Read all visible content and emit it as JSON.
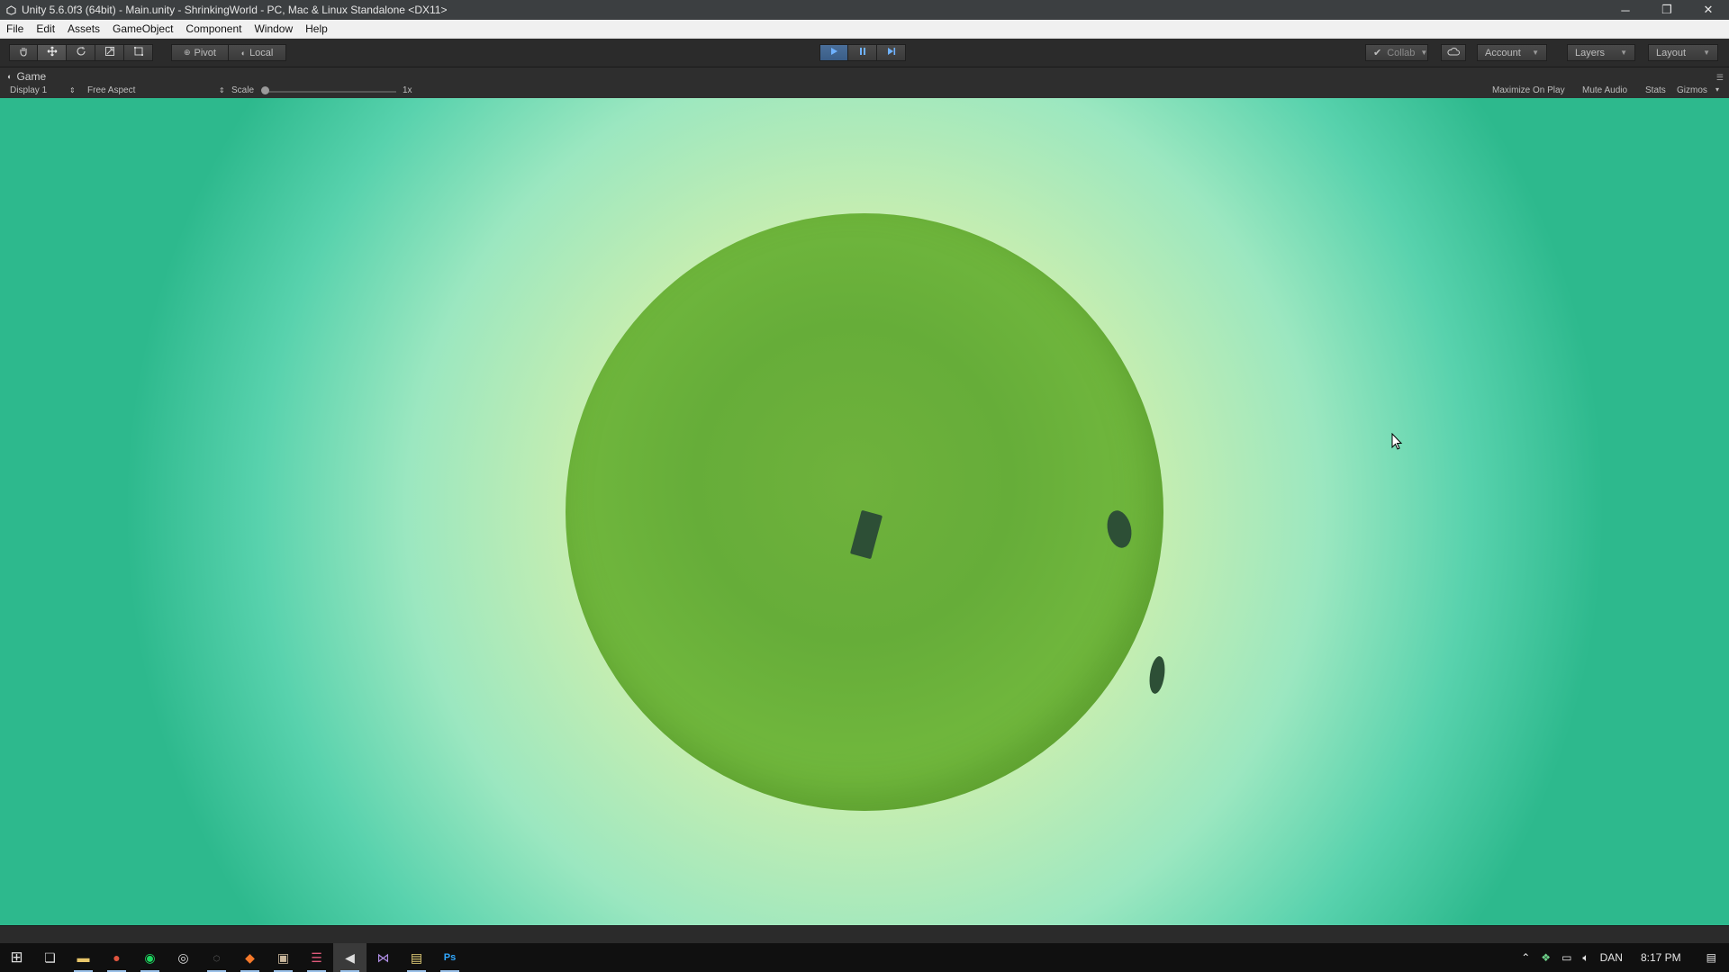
{
  "window": {
    "title": "Unity 5.6.0f3 (64bit) - Main.unity - ShrinkingWorld - PC, Mac & Linux Standalone <DX11>",
    "controls": {
      "minimize": "─",
      "restore": "❐",
      "close": "✕"
    }
  },
  "menu": {
    "items": [
      {
        "label": "File"
      },
      {
        "label": "Edit"
      },
      {
        "label": "Assets"
      },
      {
        "label": "GameObject"
      },
      {
        "label": "Component"
      },
      {
        "label": "Window"
      },
      {
        "label": "Help"
      }
    ]
  },
  "toolbar": {
    "tools": [
      "hand-icon",
      "move-icon",
      "rotate-icon",
      "scale-icon",
      "rect-tool-icon"
    ],
    "pivot_label": "Pivot",
    "local_label": "Local",
    "playback": [
      "play-icon",
      "pause-icon",
      "step-icon"
    ],
    "collab_label": "Collab",
    "account_label": "Account",
    "layers_label": "Layers",
    "layout_label": "Layout",
    "playing_color": "#3a5d87"
  },
  "game": {
    "tab_label": "Game",
    "display_label": "Display 1",
    "aspect_label": "Free Aspect",
    "scale_label": "Scale",
    "scale_value": "1x",
    "maximize_label": "Maximize On Play",
    "mute_label": "Mute Audio",
    "stats_label": "Stats",
    "gizmos_label": "Gizmos"
  },
  "scene": {
    "sky_color": "#2db98d",
    "halo_color": "#eaf3b3",
    "planet_color": "#6fb23c",
    "tree_color": "#2d4f36"
  },
  "taskbar": {
    "apps": [
      {
        "name": "windows-start-icon",
        "glyph": "⊞"
      },
      {
        "name": "task-view-icon",
        "glyph": "❏"
      },
      {
        "name": "file-explorer-icon",
        "glyph": "▬"
      },
      {
        "name": "chrome-icon",
        "glyph": "●"
      },
      {
        "name": "spotify-icon",
        "glyph": "◉"
      },
      {
        "name": "app-icon-6",
        "glyph": "◎"
      },
      {
        "name": "app-icon-7",
        "glyph": "◌"
      },
      {
        "name": "blender-icon",
        "glyph": "◆"
      },
      {
        "name": "app-icon-9",
        "glyph": "▣"
      },
      {
        "name": "app-icon-10",
        "glyph": "☰"
      },
      {
        "name": "unity-icon",
        "glyph": "◀"
      },
      {
        "name": "visual-studio-icon",
        "glyph": "⋈"
      },
      {
        "name": "notepad-icon",
        "glyph": "▤"
      },
      {
        "name": "photoshop-icon",
        "glyph": "Ps"
      }
    ],
    "tray": {
      "language": "DAN",
      "time": "8:17 PM"
    }
  }
}
